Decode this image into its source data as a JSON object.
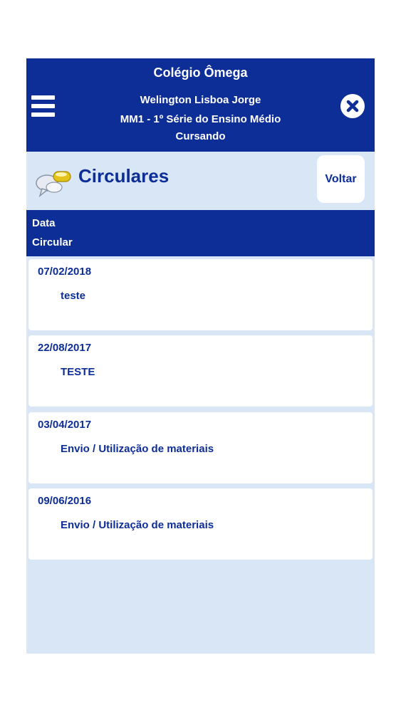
{
  "header": {
    "school": "Colégio Ômega",
    "student": "Welington Lisboa Jorge",
    "grade": "MM1 - 1º Série do Ensino Médio",
    "status": "Cursando"
  },
  "page": {
    "title": "Circulares",
    "back_label": "Voltar",
    "icon": "speech-bubbles-icon"
  },
  "table": {
    "columns": [
      "Data",
      "Circular"
    ]
  },
  "circulars": [
    {
      "date": "07/02/2018",
      "title": "teste"
    },
    {
      "date": "22/08/2017",
      "title": "TESTE"
    },
    {
      "date": "03/04/2017",
      "title": "Envio / Utilização de materiais"
    },
    {
      "date": "09/06/2016",
      "title": "Envio / Utilização de materiais"
    }
  ],
  "colors": {
    "primary": "#0d2d97",
    "background": "#d9e6f5",
    "card": "#ffffff"
  }
}
